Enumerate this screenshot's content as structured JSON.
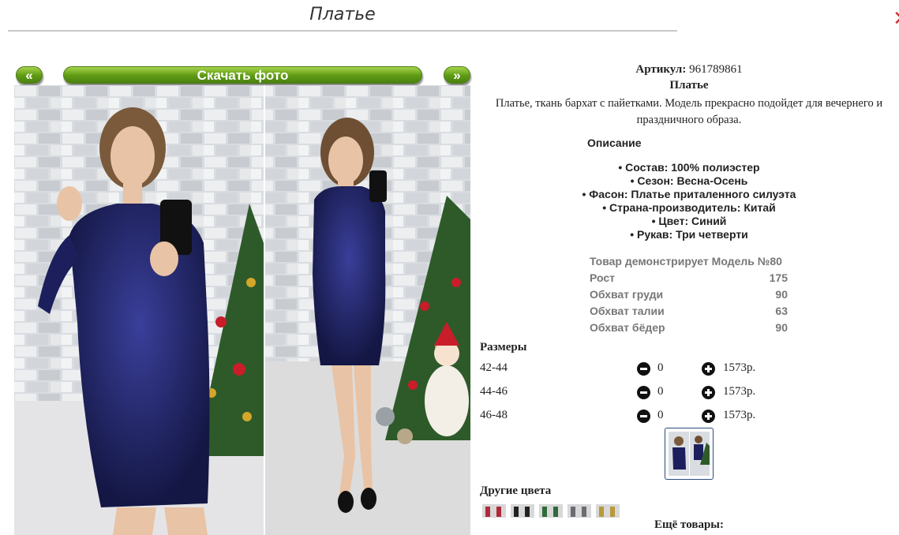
{
  "page": {
    "title": "Платье",
    "download_label": "Скачать фото",
    "prev_label": "«",
    "next_label": "»"
  },
  "product": {
    "article_label": "Артикул:",
    "article_value": "961789861",
    "name": "Платье",
    "short_description": "Платье, ткань бархат с пайетками. Модель прекрасно подойдет для вечернего и праздничного образа.",
    "description_heading": "Описание",
    "features": [
      "• Состав: 100% полиэстер",
      "• Сезон: Весна-Осень",
      "• Фасон: Платье приталенного силуэта",
      "• Страна-производитель: Китай",
      "• Цвет: Синий",
      "• Рукав: Три четверти"
    ]
  },
  "model": {
    "title": "Товар демонстрирует Модель №80",
    "params": [
      {
        "label": "Рост",
        "value": "175"
      },
      {
        "label": "Обхват груди",
        "value": "90"
      },
      {
        "label": "Обхват талии",
        "value": "63"
      },
      {
        "label": "Обхват бёдер",
        "value": "90"
      }
    ]
  },
  "sizes": {
    "heading": "Размеры",
    "rows": [
      {
        "name": "42-44",
        "qty": "0",
        "price": "1573р."
      },
      {
        "name": "44-46",
        "qty": "0",
        "price": "1573р."
      },
      {
        "name": "46-48",
        "qty": "0",
        "price": "1573р."
      }
    ]
  },
  "other_colors_heading": "Другие цвета",
  "more_products_heading": "Ещё товары:",
  "colors": {
    "button_green": "#5e9a14",
    "dress_blue": "#1c1f5c",
    "thumb_border": "#2a4a7a"
  }
}
